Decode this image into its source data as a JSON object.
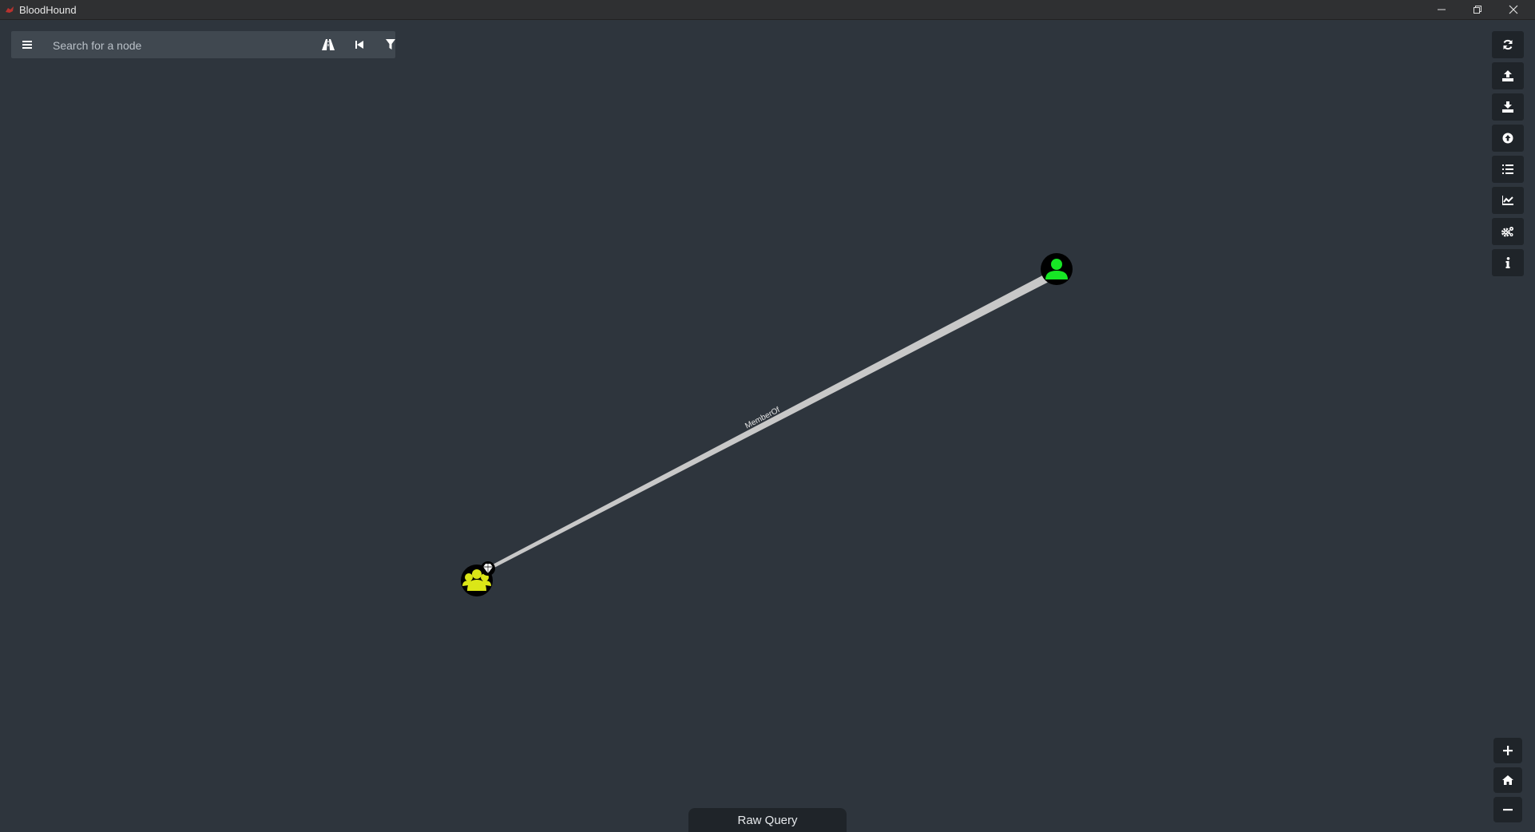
{
  "window": {
    "title": "BloodHound"
  },
  "search": {
    "placeholder": "Search for a node",
    "value": ""
  },
  "icons": {
    "menu": "hamburger-menu-icon",
    "pathfinding": "road-icon",
    "back": "step-backward-icon",
    "filter": "filter-icon",
    "refresh": "refresh-icon",
    "export": "upload-icon",
    "import": "download-icon",
    "upload_data": "arrow-circle-up-icon",
    "queries": "list-icon",
    "stats": "line-chart-icon",
    "settings": "cogs-icon",
    "about": "info-icon",
    "zoom_in": "plus-icon",
    "home": "home-icon",
    "zoom_out": "minus-icon"
  },
  "graph": {
    "nodes": [
      {
        "id": "user",
        "type": "User",
        "color": "#17e625"
      },
      {
        "id": "group",
        "type": "Group",
        "color": "#dbe617",
        "high_value": true
      }
    ],
    "edges": [
      {
        "source": "user",
        "target": "group",
        "label": "MemberOf"
      }
    ]
  },
  "raw_query": {
    "label": "Raw Query"
  },
  "colors": {
    "background": "#2e353d",
    "panel": "#1f2429",
    "searchbar": "#404850",
    "edge": "#c8c8c8",
    "user_node": "#17e625",
    "group_node": "#dbe617",
    "node_bg": "#000000"
  }
}
